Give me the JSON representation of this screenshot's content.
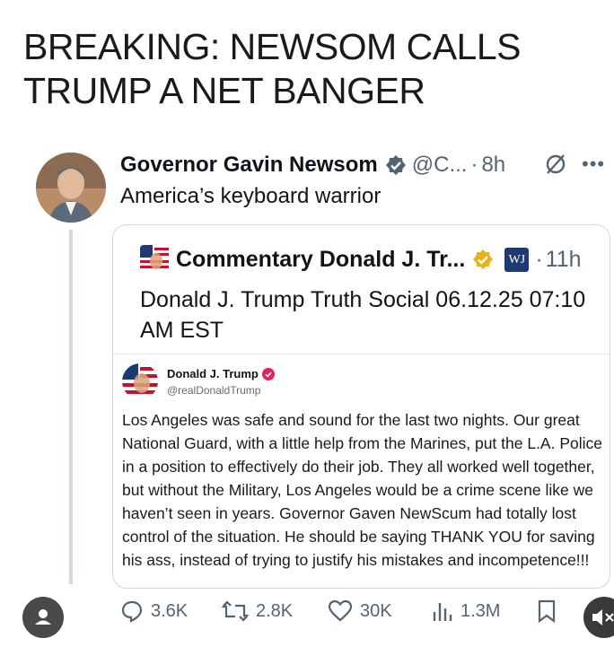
{
  "headline": "BREAKING: NEWSOM CALLS TRUMP A NET BANGER",
  "tweet": {
    "author_name": "Governor Gavin Newsom",
    "handle": "@C...",
    "separator": "·",
    "time": "8h",
    "more_icon": "•••",
    "text": "America’s keyboard warrior"
  },
  "quote": {
    "author_name": "Commentary Donald J. Tr...",
    "badge_text": "WJ",
    "separator": "·",
    "time": "11h",
    "text": "Donald J. Trump Truth Social 06.12.25 07:10 AM EST",
    "embedded": {
      "name": "Donald J. Trump",
      "handle": "@realDonaldTrump",
      "body": "Los Angeles was safe and sound for the last two nights. Our great National Guard, with a little help from the Marines, put the L.A. Police in a position to effectively do their job. They all worked well together, but without the Military, Los Angeles would be a crime scene like we haven’t seen in years. Governor Gaven NewScum had totally lost control of the situation. He should be saying THANK YOU for saving his ass, instead of trying to justify his mistakes and incompetence!!!"
    }
  },
  "actions": {
    "replies": "3.6K",
    "reposts": "2.8K",
    "likes": "30K",
    "views": "1.3M"
  },
  "icons": [
    "verified-badge-icon",
    "gold-verified-badge-icon",
    "grok-icon",
    "reply-icon",
    "repost-icon",
    "like-icon",
    "views-icon",
    "bookmark-icon",
    "profile-icon",
    "mute-icon"
  ],
  "colors": {
    "verified_gray": "#536471",
    "gold_badge": "#e8b21a",
    "truth_badge": "#e0245e",
    "wj_badge": "#1d3a72"
  }
}
